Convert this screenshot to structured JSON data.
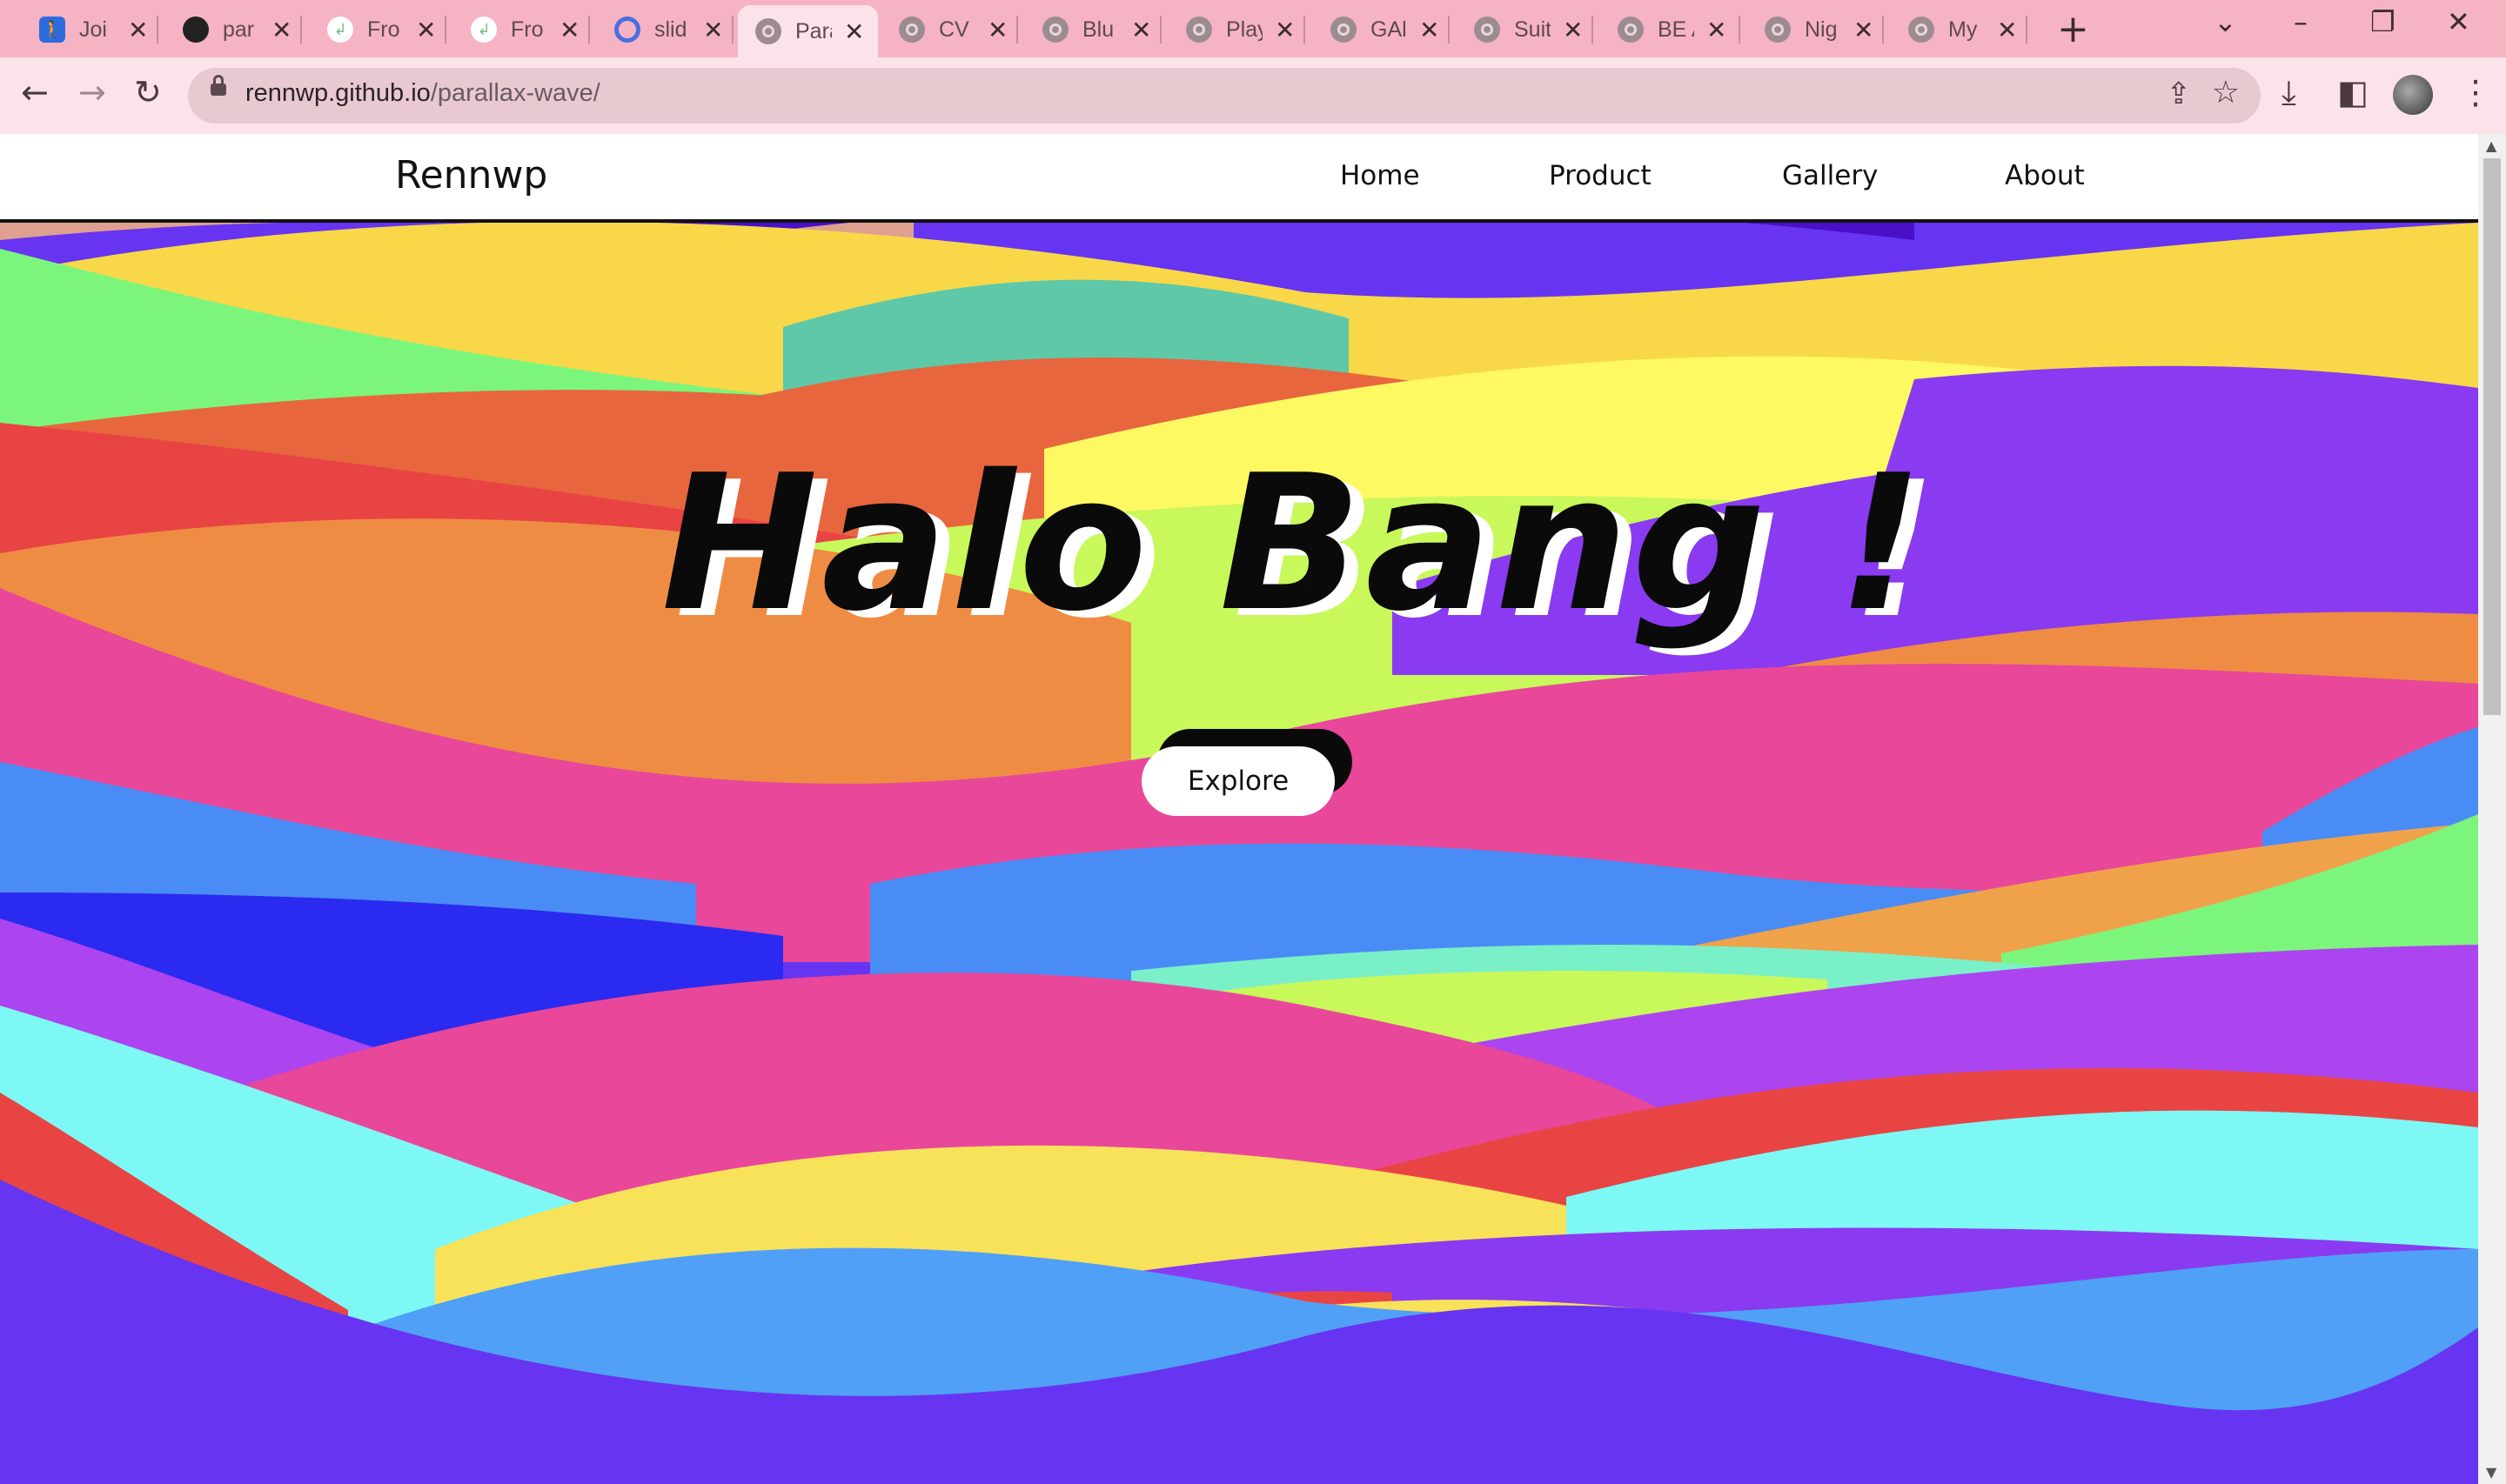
{
  "browser": {
    "tabs": [
      {
        "title": "Joi",
        "icon": "hiking-icon"
      },
      {
        "title": "par",
        "icon": "github-icon"
      },
      {
        "title": "Fro",
        "icon": "site-icon"
      },
      {
        "title": "Fro",
        "icon": "site-icon"
      },
      {
        "title": "slid",
        "icon": "ring-icon"
      },
      {
        "title": "Para",
        "icon": "globe-icon",
        "active": true
      },
      {
        "title": "CV",
        "icon": "globe-icon"
      },
      {
        "title": "Blu",
        "icon": "globe-icon"
      },
      {
        "title": "Play",
        "icon": "globe-icon"
      },
      {
        "title": "GAl",
        "icon": "globe-icon"
      },
      {
        "title": "Suit",
        "icon": "globe-icon"
      },
      {
        "title": "BE A",
        "icon": "globe-icon"
      },
      {
        "title": "Nig",
        "icon": "globe-icon"
      },
      {
        "title": "My",
        "icon": "globe-icon"
      }
    ],
    "new_tab": "+",
    "url_host": "rennwp.github.io",
    "url_path": "/parallax-wave/",
    "colors": {
      "tabbar": "#f6b3c4",
      "toolbar": "#fce3e9"
    }
  },
  "page": {
    "brand": "Rennwp",
    "nav": [
      "Home",
      "Product",
      "Gallery",
      "About"
    ],
    "hero_title": "Halo Bang !",
    "explore_label": "Explore",
    "colors": {
      "base": "#6734f2",
      "waves": [
        "#e0a090",
        "#4a10c8",
        "#f8d848",
        "#5ec8a8",
        "#7cf57c",
        "#e8663e",
        "#fef862",
        "#8a3af0",
        "#e84444",
        "#ef8c44",
        "#c8f85a",
        "#e8479a",
        "#4a8cf5",
        "#2a2af0",
        "#f0a24a",
        "#7af0c8",
        "#ac44f0",
        "#7ef8f4",
        "#f8e25a",
        "#50a0f8"
      ]
    }
  }
}
